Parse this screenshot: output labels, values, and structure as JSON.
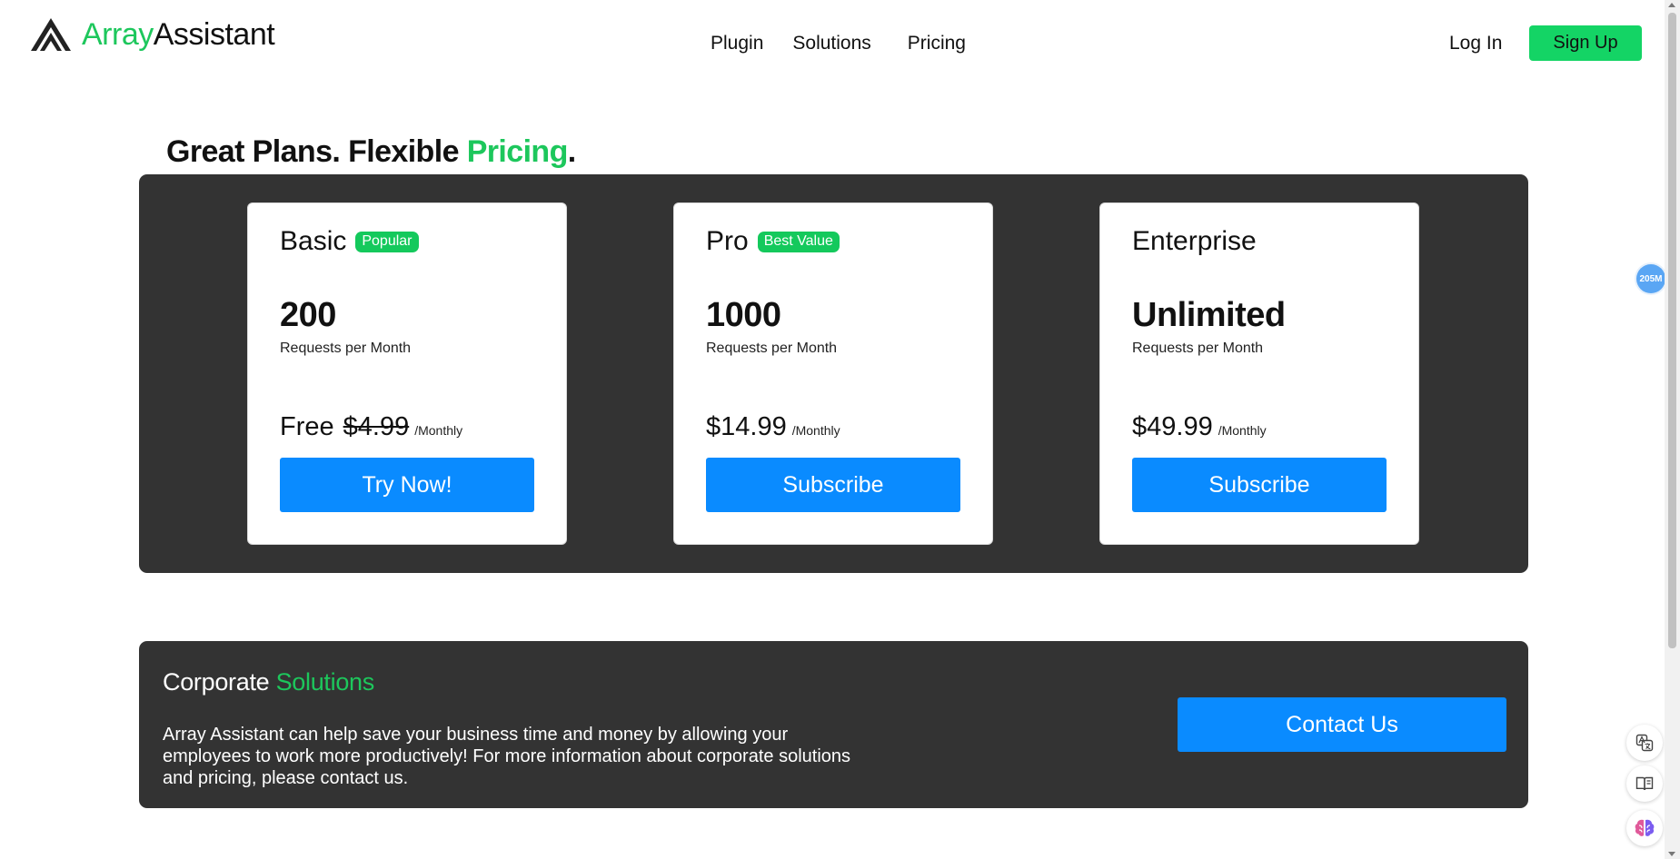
{
  "brand": {
    "name_part1": "Array",
    "name_part2": "Assistant"
  },
  "nav": {
    "items": [
      {
        "label": "Plugin"
      },
      {
        "label": "Solutions"
      },
      {
        "label": "Pricing"
      }
    ],
    "login_label": "Log In",
    "signup_label": "Sign Up"
  },
  "headline": {
    "part1": "Great Plans. Flexible ",
    "highlight": "Pricing",
    "part2": "."
  },
  "plans": [
    {
      "name": "Basic",
      "badge": "Popular",
      "quantity": "200",
      "quantity_label": "Requests per Month",
      "price": "Free",
      "old_price": "$4.99",
      "period": "/Monthly",
      "button_label": "Try Now!"
    },
    {
      "name": "Pro",
      "badge": "Best Value",
      "quantity": "1000",
      "quantity_label": "Requests per Month",
      "price": "$14.99",
      "period": "/Monthly",
      "button_label": "Subscribe"
    },
    {
      "name": "Enterprise",
      "quantity": "Unlimited",
      "quantity_label": "Requests per Month",
      "price": "$49.99",
      "period": "/Monthly",
      "button_label": "Subscribe"
    }
  ],
  "corporate": {
    "title_part1": "Corporate ",
    "title_highlight": "Solutions",
    "description": "Array Assistant can help save your business time and money by allowing your employees to work more productively! For more information about corporate solutions and pricing, please contact us.",
    "button_label": "Contact Us"
  },
  "extension_badge": {
    "text": "205M"
  },
  "colors": {
    "brand_green": "#1dc75c",
    "signup_green": "#14d465",
    "button_blue": "#0a8bff",
    "panel_dark": "#333333"
  }
}
